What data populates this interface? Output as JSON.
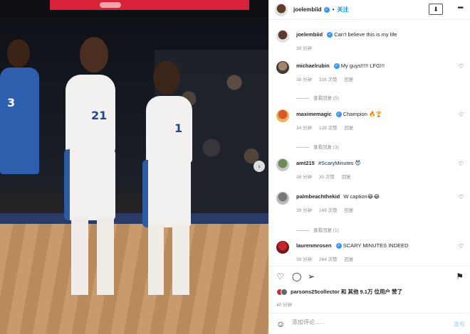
{
  "post": {
    "author": "joelembiid",
    "follow_label": "关注",
    "separator": "•",
    "caption_user": "joelembiid",
    "caption_text": "Can't believe this is my life",
    "caption_time": "39 分钟"
  },
  "photo": {
    "jersey_left": "21",
    "jersey_right": "1",
    "jersey_blue": "3",
    "next_glyph": "›"
  },
  "comments": [
    {
      "user": "michaelrubin",
      "verified": true,
      "text": "My guys!!!!! LFG!!!",
      "time": "38 分钟",
      "likes": "316 次赞",
      "reply": "回复"
    },
    {
      "user": "maximemagic",
      "verified": true,
      "text": "Champion 🔥🏆",
      "time": "34 分钟",
      "likes": "128 次赞",
      "reply": "回复"
    },
    {
      "user": "amt215",
      "verified": false,
      "text": "#ScaryMinutes 😈",
      "time": "38 分钟",
      "likes": "30 次赞",
      "reply": "回复"
    },
    {
      "user": "palmbeachthekid",
      "verified": false,
      "text": "W caption😂😂",
      "time": "39 分钟",
      "likes": "149 次赞",
      "reply": "回复"
    },
    {
      "user": "laurenmrosen",
      "verified": true,
      "text": "SCARY MINUTES INDEED",
      "time": "39 分钟",
      "likes": "264 次赞",
      "reply": "回复"
    }
  ],
  "view_replies": [
    "查看回复 (5)",
    "查看回复 (3)",
    "查看回复 (1)"
  ],
  "likes_line": {
    "user": "parsons25collector",
    "rest": "和 其他 9.1万 位用户 赞了"
  },
  "post_time": "40 分钟",
  "comment_box": {
    "placeholder": "添加评论......",
    "post_label": "发布"
  },
  "icons": {
    "heart": "♡",
    "comment": "◯",
    "share": "➢",
    "bookmark": "⚑",
    "more": "•••",
    "save": "⬇",
    "emoji": "☺"
  }
}
